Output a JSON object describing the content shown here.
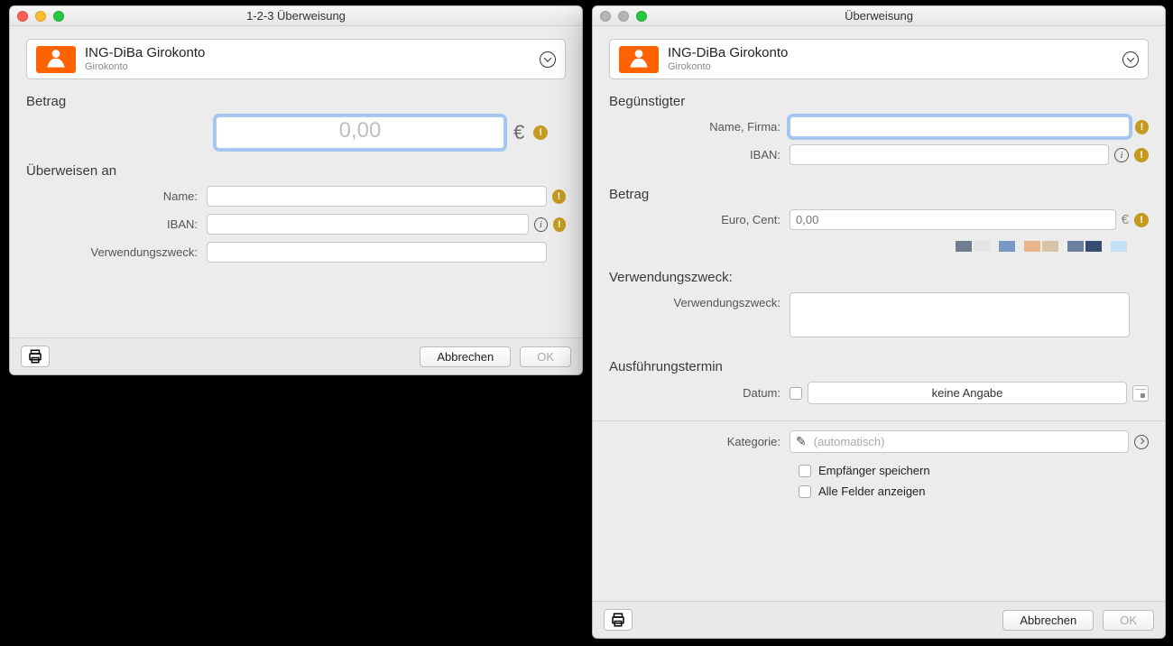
{
  "left": {
    "title": "1-2-3 Überweisung",
    "account": {
      "name": "ING-DiBa Girokonto",
      "subtitle": "Girokonto"
    },
    "sections": {
      "amount": "Betrag",
      "transfer_to": "Überweisen an"
    },
    "fields": {
      "amount_placeholder": "0,00",
      "currency": "€",
      "name_label": "Name:",
      "iban_label": "IBAN:",
      "purpose_label": "Verwendungszweck:"
    },
    "footer": {
      "cancel": "Abbrechen",
      "ok": "OK"
    }
  },
  "right": {
    "title": "Überweisung",
    "account": {
      "name": "ING-DiBa Girokonto",
      "subtitle": "Girokonto"
    },
    "sections": {
      "beneficiary": "Begünstigter",
      "amount": "Betrag",
      "purpose": "Verwendungszweck:",
      "execution": "Ausführungstermin"
    },
    "fields": {
      "name_label": "Name, Firma:",
      "iban_label": "IBAN:",
      "amount_label": "Euro, Cent:",
      "amount_placeholder": "0,00",
      "currency": "€",
      "purpose_label": "Verwendungszweck:",
      "date_label": "Datum:",
      "date_value": "keine Angabe",
      "category_label": "Kategorie:",
      "category_placeholder": "(automatisch)",
      "save_recipient": "Empfänger speichern",
      "show_all": "Alle Felder anzeigen"
    },
    "swatches": [
      "#6f7d91",
      "#e4e4e4",
      "gap",
      "#7598c5",
      "gap",
      "#e7b38a",
      "#d7c4a7",
      "gap",
      "#6d7f9f",
      "#384c73",
      "gap",
      "#c4e0f5"
    ],
    "footer": {
      "cancel": "Abbrechen",
      "ok": "OK"
    }
  }
}
